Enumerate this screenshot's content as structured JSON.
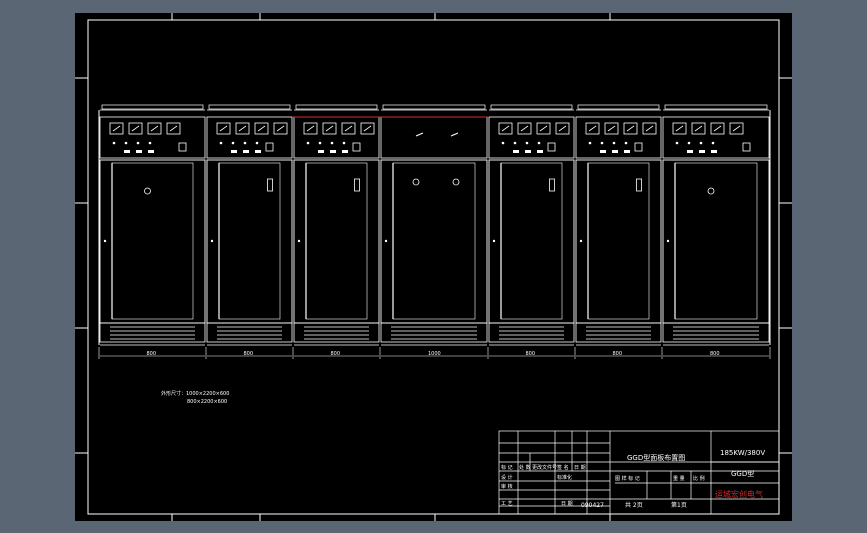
{
  "drawing": {
    "panel_widths": [
      "800",
      "800",
      "800",
      "1000",
      "800",
      "800",
      "800"
    ],
    "panel_types": [
      "meters",
      "meters",
      "meters",
      "blank",
      "meters",
      "meters",
      "meters"
    ],
    "door_knob": [
      "round",
      "switch",
      "switch",
      "double",
      "switch",
      "switch",
      "round"
    ],
    "note_line1": "外形尺寸：1000×2200×600",
    "note_line2": "800×2200×600"
  },
  "title_block": {
    "drawing_title": "GGD型面板布置图",
    "spec": "185KW/380V",
    "model": "GGD型",
    "company": "运城宏创电气",
    "date": "090427",
    "sheet_total": "共 2页",
    "sheet_no": "第1页",
    "row_labels": [
      "标 记",
      "处 数",
      "更改文件号",
      "签 名",
      "日 期"
    ],
    "col_labels": [
      "图 样 标 记",
      "重 量",
      "比 例"
    ],
    "signers": [
      "设 计",
      "审 核",
      "工 艺"
    ],
    "std_label": "标准化",
    "approve_label": "日 期"
  },
  "colors": {
    "background": "#5b6675",
    "sheet": "#000000",
    "line": "#ffffff",
    "accent": "#d03020",
    "company_text": "#d02828"
  }
}
